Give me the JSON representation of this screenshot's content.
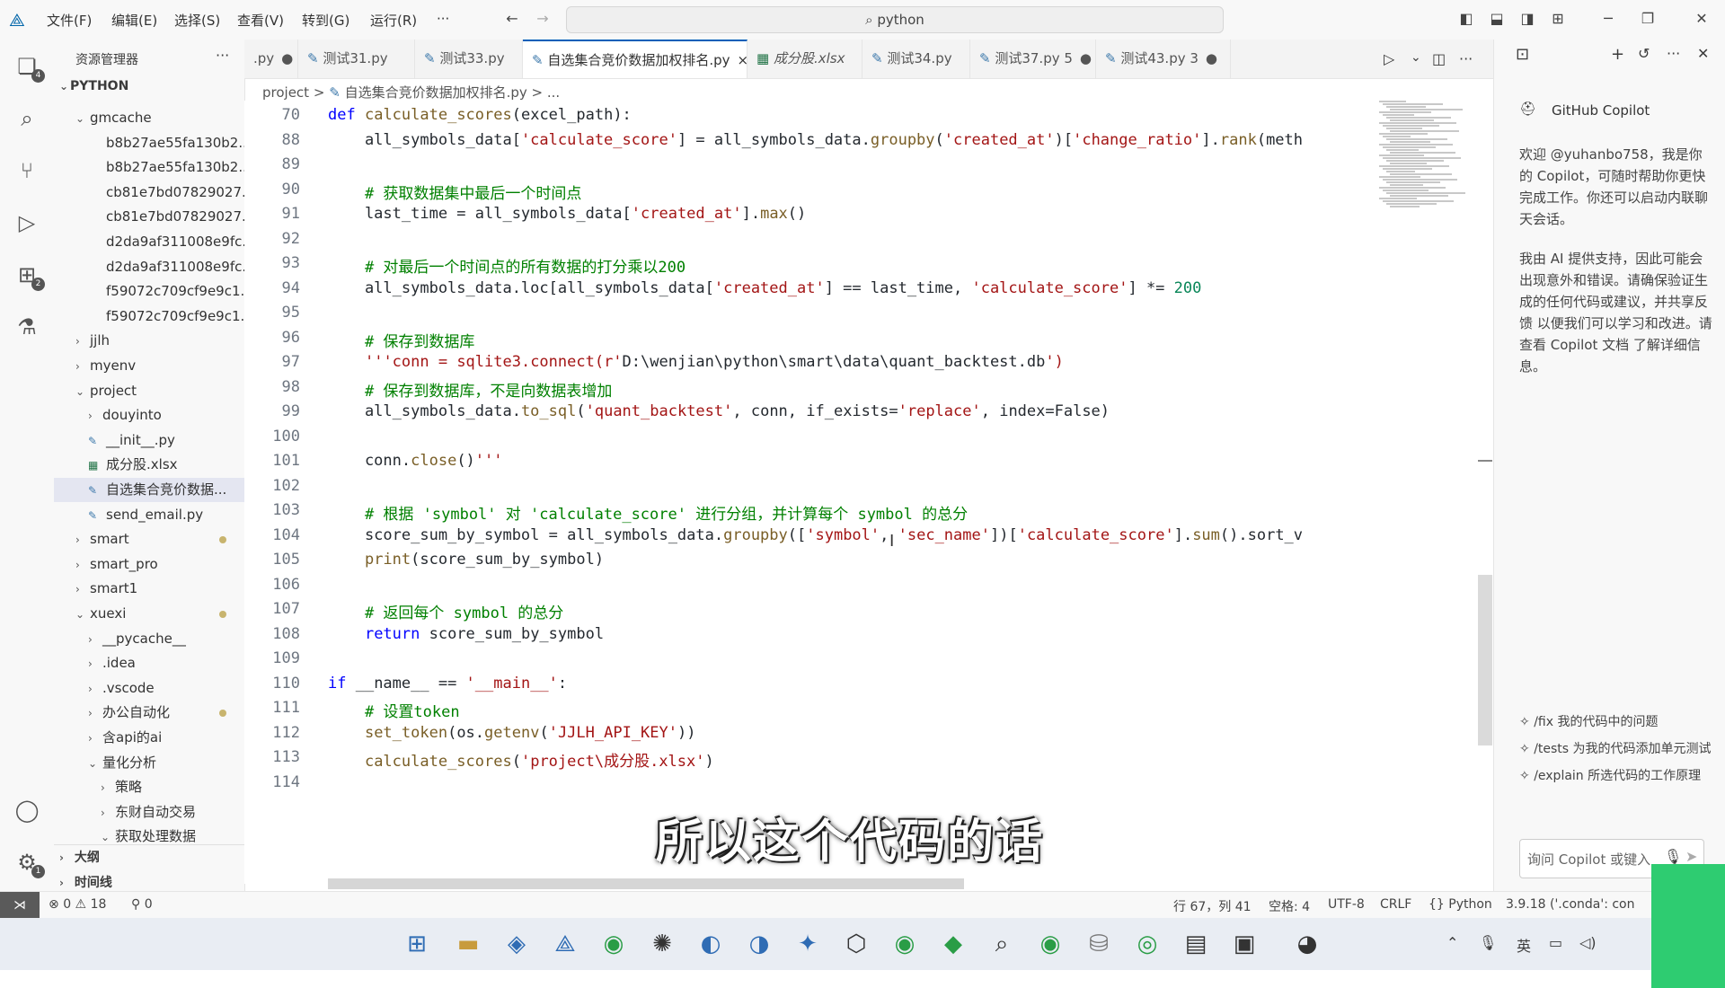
{
  "menu": [
    "文件(F)",
    "编辑(E)",
    "选择(S)",
    "查看(V)",
    "转到(G)",
    "运行(R)",
    "···"
  ],
  "search": {
    "value": "python"
  },
  "sidebar": {
    "title": "资源管理器",
    "root": "PYTHON",
    "rows": [
      {
        "label": "gmcache",
        "kind": "folder-open",
        "indent": 1
      },
      {
        "label": "b8b27ae55fa130b2...",
        "kind": "file",
        "indent": 2
      },
      {
        "label": "b8b27ae55fa130b2...",
        "kind": "file",
        "indent": 2
      },
      {
        "label": "cb81e7bd07829027...",
        "kind": "file",
        "indent": 2
      },
      {
        "label": "cb81e7bd07829027...",
        "kind": "file",
        "indent": 2
      },
      {
        "label": "d2da9af311008e9fc...",
        "kind": "file",
        "indent": 2
      },
      {
        "label": "d2da9af311008e9fc...",
        "kind": "file",
        "indent": 2
      },
      {
        "label": "f59072c709cf9e9c1...",
        "kind": "file",
        "indent": 2
      },
      {
        "label": "f59072c709cf9e9c1...",
        "kind": "file",
        "indent": 2
      },
      {
        "label": "jjlh",
        "kind": "folder",
        "indent": 1
      },
      {
        "label": "myenv",
        "kind": "folder",
        "indent": 1
      },
      {
        "label": "project",
        "kind": "folder-open",
        "indent": 1
      },
      {
        "label": "douyinto",
        "kind": "folder",
        "indent": 2
      },
      {
        "label": "__init__.py",
        "kind": "py",
        "indent": 2
      },
      {
        "label": "成分股.xlsx",
        "kind": "xlsx",
        "indent": 2
      },
      {
        "label": "自选集合竞价数据...",
        "kind": "py",
        "indent": 2,
        "selected": true
      },
      {
        "label": "send_email.py",
        "kind": "py",
        "indent": 2
      },
      {
        "label": "smart",
        "kind": "folder",
        "indent": 1,
        "dot": true
      },
      {
        "label": "smart_pro",
        "kind": "folder",
        "indent": 1
      },
      {
        "label": "smart1",
        "kind": "folder",
        "indent": 1
      },
      {
        "label": "xuexi",
        "kind": "folder-open",
        "indent": 1,
        "dot": true
      },
      {
        "label": "__pycache__",
        "kind": "folder",
        "indent": 2
      },
      {
        "label": ".idea",
        "kind": "folder",
        "indent": 2
      },
      {
        "label": ".vscode",
        "kind": "folder",
        "indent": 2
      },
      {
        "label": "办公自动化",
        "kind": "folder",
        "indent": 2,
        "dot": true
      },
      {
        "label": "含api的ai",
        "kind": "folder",
        "indent": 2
      },
      {
        "label": "量化分析",
        "kind": "folder-open",
        "indent": 2
      },
      {
        "label": "策略",
        "kind": "folder",
        "indent": 3
      },
      {
        "label": "东财自动交易",
        "kind": "folder",
        "indent": 3
      },
      {
        "label": "获取处理数据",
        "kind": "folder-open",
        "indent": 3
      }
    ],
    "outline": "大纲",
    "timeline": "时间线"
  },
  "tabs": [
    {
      "label": ".py",
      "mark": "●"
    },
    {
      "label": "测试31.py",
      "mark": ""
    },
    {
      "label": "测试33.py",
      "mark": ""
    },
    {
      "label": "自选集合竞价数据加权排名.py",
      "mark": "×",
      "active": true
    },
    {
      "label": "成分股.xlsx",
      "mark": ""
    },
    {
      "label": "测试34.py",
      "mark": ""
    },
    {
      "label": "测试37.py 5",
      "mark": "●"
    },
    {
      "label": "测试43.py 3",
      "mark": "●"
    }
  ],
  "breadcrumb": {
    "part1": "project",
    "sep": ">",
    "part2": "自选集合竞价数据加权排名.py",
    "part3": "> ..."
  },
  "code_lines": [
    {
      "n": "70",
      "t": "def calculate_scores(excel_path):"
    },
    {
      "n": "88",
      "t": "    all_symbols_data['calculate_score'] = all_symbols_data.groupby('created_at')['change_ratio'].rank(meth"
    },
    {
      "n": "89",
      "t": ""
    },
    {
      "n": "90",
      "t": "    # 获取数据集中最后一个时间点"
    },
    {
      "n": "91",
      "t": "    last_time = all_symbols_data['created_at'].max()"
    },
    {
      "n": "92",
      "t": ""
    },
    {
      "n": "93",
      "t": "    # 对最后一个时间点的所有数据的打分乘以200"
    },
    {
      "n": "94",
      "t": "    all_symbols_data.loc[all_symbols_data['created_at'] == last_time, 'calculate_score'] *= 200"
    },
    {
      "n": "95",
      "t": ""
    },
    {
      "n": "96",
      "t": "    # 保存到数据库"
    },
    {
      "n": "97",
      "t": "    '''conn = sqlite3.connect(r'D:\\wenjian\\python\\smart\\data\\quant_backtest.db')"
    },
    {
      "n": "98",
      "t": "    # 保存到数据库，不是向数据表增加"
    },
    {
      "n": "99",
      "t": "    all_symbols_data.to_sql('quant_backtest', conn, if_exists='replace', index=False)"
    },
    {
      "n": "100",
      "t": ""
    },
    {
      "n": "101",
      "t": "    conn.close()'''"
    },
    {
      "n": "102",
      "t": ""
    },
    {
      "n": "103",
      "t": "    # 根据 'symbol' 对 'calculate_score' 进行分组，并计算每个 symbol 的总分"
    },
    {
      "n": "104",
      "t": "    score_sum_by_symbol = all_symbols_data.groupby(['symbol', 'sec_name'])['calculate_score'].sum().sort_v"
    },
    {
      "n": "105",
      "t": "    print(score_sum_by_symbol)"
    },
    {
      "n": "106",
      "t": ""
    },
    {
      "n": "107",
      "t": "    # 返回每个 symbol 的总分"
    },
    {
      "n": "108",
      "t": "    return score_sum_by_symbol"
    },
    {
      "n": "109",
      "t": ""
    },
    {
      "n": "110",
      "t": "if __name__ == '__main__':"
    },
    {
      "n": "111",
      "t": "    # 设置token"
    },
    {
      "n": "112",
      "t": "    set_token(os.getenv('JJLH_API_KEY'))"
    },
    {
      "n": "113",
      "t": "    calculate_scores('project\\成分股.xlsx')"
    },
    {
      "n": "114",
      "t": ""
    }
  ],
  "copilot": {
    "title": "GitHub Copilot",
    "welcome": "欢迎 @yuhanbo758，我是你的 Copilot，可随时帮助你更快完成工作。你还可以启动内联聊天会话。",
    "disclaimer": "我由 AI 提供支持，因此可能会出现意外和错误。请确保验证生成的任何代码或建议，并共享反馈 以便我们可以学习和改进。请查看 Copilot 文档 了解详细信息。",
    "suggestions": [
      "/fix 我的代码中的问题",
      "/tests 为我的代码添加单元测试",
      "/explain 所选代码的工作原理"
    ],
    "input_placeholder": "询问 Copilot 或键入"
  },
  "caption": "所以这个代码的话",
  "status": {
    "errors": "0",
    "warnings": "18",
    "ports": "0",
    "position": "行 67，列 41",
    "spaces": "空格: 4",
    "encoding": "UTF-8",
    "eol": "CRLF",
    "language": "Python",
    "interpreter": "3.9.18 ('.conda': con"
  },
  "taskbar": {
    "ime": "英"
  },
  "colors": {
    "accent": "#005fb8",
    "keyword": "#0000ff",
    "string": "#a31515",
    "comment": "#008000"
  }
}
